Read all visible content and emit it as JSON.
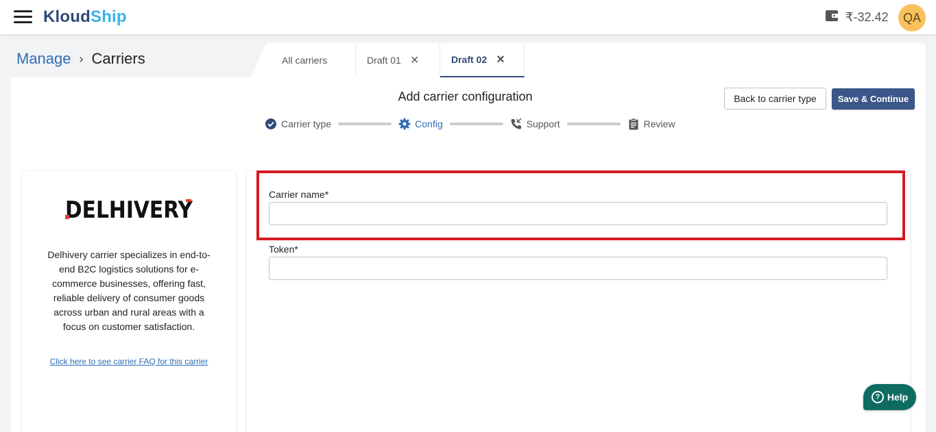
{
  "app": {
    "logo_part1": "Kloud",
    "logo_part2": "Ship"
  },
  "header": {
    "balance": "₹-32.42",
    "avatar_initials": "QA"
  },
  "breadcrumb": {
    "parent": "Manage",
    "current": "Carriers"
  },
  "tabs": [
    {
      "label": "All carriers"
    },
    {
      "label": "Draft 01"
    },
    {
      "label": "Draft 02"
    }
  ],
  "page": {
    "title": "Add carrier configuration",
    "back_button": "Back to carrier type",
    "save_button": "Save & Continue"
  },
  "stepper": {
    "steps": [
      {
        "label": "Carrier type",
        "icon": "check-circle-icon"
      },
      {
        "label": "Config",
        "icon": "gear-icon"
      },
      {
        "label": "Support",
        "icon": "phone-icon"
      },
      {
        "label": "Review",
        "icon": "clipboard-icon"
      }
    ]
  },
  "carrier": {
    "logo_text": "DELHIVERY",
    "description": "Delhivery carrier specializes in end-to-end B2C logistics solutions for e-commerce businesses, offering fast, reliable delivery of consumer goods across urban and rural areas with a focus on customer satisfaction.",
    "faq_link": "Click here to see carrier FAQ for this carrier"
  },
  "form": {
    "carrier_name_label": "Carrier name*",
    "carrier_name_value": "",
    "token_label": "Token*",
    "token_value": ""
  },
  "help": {
    "label": "Help"
  },
  "colors": {
    "brand_dark": "#2f4a7a",
    "brand_light": "#3bb0e8",
    "highlight": "#d41b23",
    "help": "#0e6b61"
  }
}
